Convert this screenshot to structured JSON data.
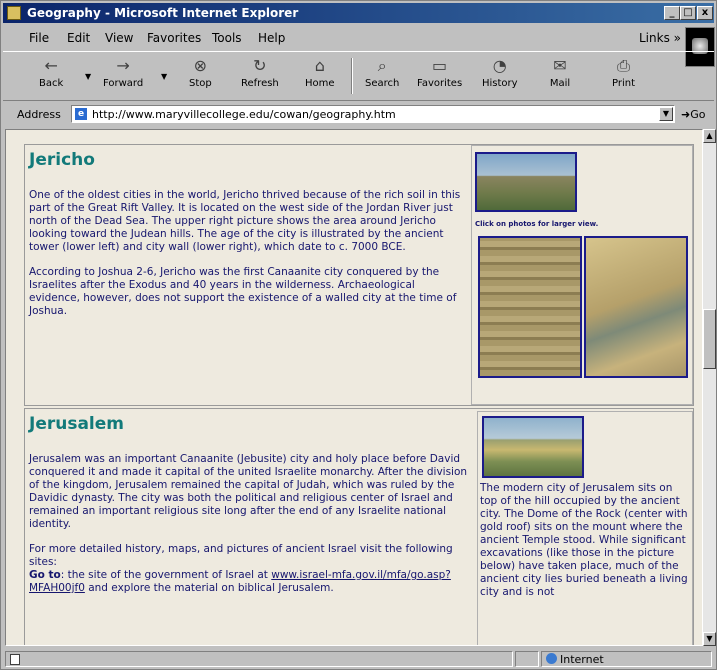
{
  "window": {
    "title": "Geography - Microsoft Internet Explorer",
    "controls": {
      "minimize": "_",
      "maximize": "□",
      "close": "x"
    }
  },
  "menu": [
    "File",
    "Edit",
    "View",
    "Favorites",
    "Tools",
    "Help"
  ],
  "links_label": "Links »",
  "toolbar": [
    {
      "label": "Back",
      "icon": "back-arrow-icon"
    },
    {
      "label": "Forward",
      "icon": "forward-arrow-icon"
    },
    {
      "label": "Stop",
      "icon": "stop-icon"
    },
    {
      "label": "Refresh",
      "icon": "refresh-icon"
    },
    {
      "label": "Home",
      "icon": "home-icon"
    },
    {
      "label": "Search",
      "icon": "search-icon"
    },
    {
      "label": "Favorites",
      "icon": "favorites-icon"
    },
    {
      "label": "History",
      "icon": "history-icon"
    },
    {
      "label": "Mail",
      "icon": "mail-icon"
    },
    {
      "label": "Print",
      "icon": "print-icon"
    }
  ],
  "address": {
    "label": "Address",
    "url": "http://www.maryvillecollege.edu/cowan/geography.htm",
    "go": "Go"
  },
  "content": {
    "jericho": {
      "title": "Jericho",
      "paragraphs": [
        "One of the oldest cities in the world, Jericho thrived because of the rich soil in this part of the Great Rift Valley.  It is located on the west side of the Jordan River just north of the Dead Sea.  The upper right picture shows the area around Jericho looking toward the Judean hills.  The age of the city is illustrated by the ancient tower (lower left) and city wall (lower right), which date to c. 7000 BCE.",
        "According to Joshua 2-6, Jericho was the first Canaanite city conquered by the Israelites after the Exodus and 40 years in the wilderness.  Archaeological evidence, however, does not support the existence of a walled city at the time of Joshua."
      ],
      "photo_caption": "Click on photos for larger view."
    },
    "jerusalem": {
      "title": "Jerusalem",
      "paragraphs": [
        "Jerusalem was an important Canaanite (Jebusite) city and holy place before David conquered it and made it capital of the united Israelite monarchy.  After the division of the kingdom, Jerusalem remained the capital of Judah, which was ruled by the Davidic dynasty.  The city was both the political and religious center of Israel and remained an important religious site long after the end of any Israelite national identity.",
        "For more detailed history, maps, and pictures of ancient Israel visit the following sites:"
      ],
      "goto_label": "Go to",
      "goto_pre": ": the site of the government of Israel at ",
      "goto_link": "www.israel-mfa.gov.il/mfa/go.asp?MFAH00jf0",
      "goto_post": " and explore the material on biblical Jerusalem.",
      "side_text": "The modern city of Jerusalem sits on top of the hill occupied by the ancient city.  The Dome of the Rock (center with gold roof) sits on the mount where the ancient Temple stood.  While significant excavations (like those in the picture below) have taken place, much of the ancient city lies buried beneath a living city and is not"
    }
  },
  "status": {
    "zone": "Internet"
  }
}
